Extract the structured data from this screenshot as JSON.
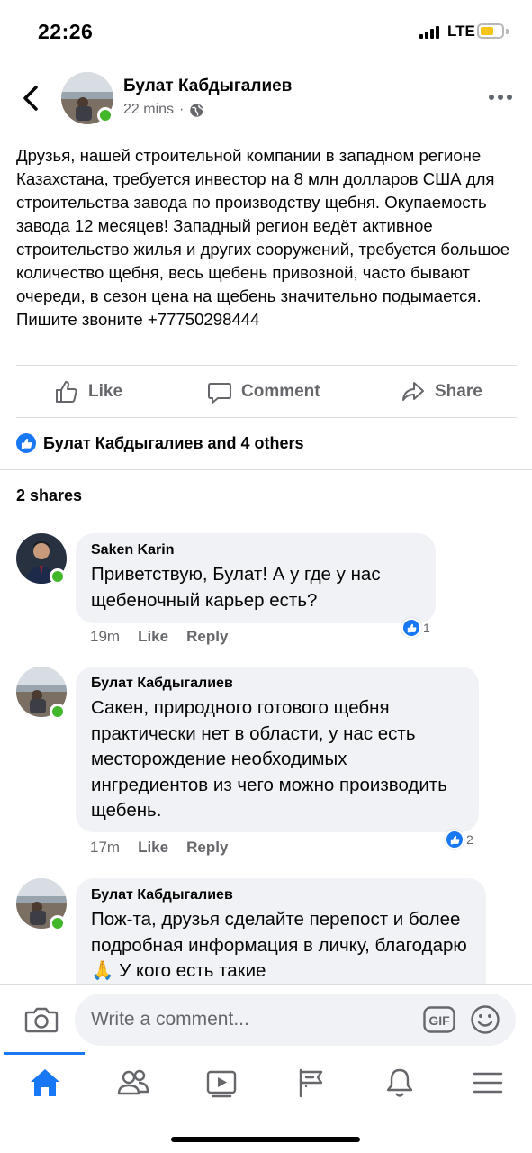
{
  "status_bar": {
    "time": "22:26",
    "network": "LTE",
    "battery_color": "#f5c518"
  },
  "post": {
    "author": "Булат Кабдыгалиев",
    "time": "22 mins",
    "separator": "·",
    "privacy_icon": "globe-icon",
    "text": "Друзья, нашей строительной компании в западном регионе Казахстана, требуется инвестор на 8 млн долларов США для строительства завода по производству щебня. Окупаемость завода 12 месяцев! Западный регион ведёт активное строительство жилья и других сооружений, требуется большое количество щебня, весь щебень привозной, часто бывают очереди, в сезон цена на щебень значительно подымается. Пишите звоните +77750298444"
  },
  "actions": {
    "like": "Like",
    "comment": "Comment",
    "share": "Share"
  },
  "reactions": {
    "text": "Булат Кабдыгалиев and 4 others"
  },
  "shares": "2 shares",
  "comments": [
    {
      "name": "Saken Karin",
      "text": "Приветствую, Булат! А у где у нас щебеночный карьер есть?",
      "time": "19m",
      "like": "Like",
      "reply": "Reply",
      "reactions": "1"
    },
    {
      "name": "Булат Кабдыгалиев",
      "text": "Сакен, природного готового щебня практически нет в области, у нас есть месторождение необходимых ингредиентов из чего можно производить щебень.",
      "time": "17m",
      "like": "Like",
      "reply": "Reply",
      "reactions": "2"
    },
    {
      "name": "Булат Кабдыгалиев",
      "text": "Пож-та, друзья сделайте перепост и более подробная информация в личку, благодарю 🙏 У кого есть такие"
    }
  ],
  "composer": {
    "placeholder": "Write a comment...",
    "gif": "GIF"
  },
  "nav": [
    "home-icon",
    "friends-icon",
    "watch-icon",
    "pages-icon",
    "notifications-icon",
    "menu-icon"
  ],
  "colors": {
    "brand": "#1877f2",
    "online": "#42b72a",
    "bubble": "#f0f2f5",
    "secondary_text": "#65676b"
  }
}
